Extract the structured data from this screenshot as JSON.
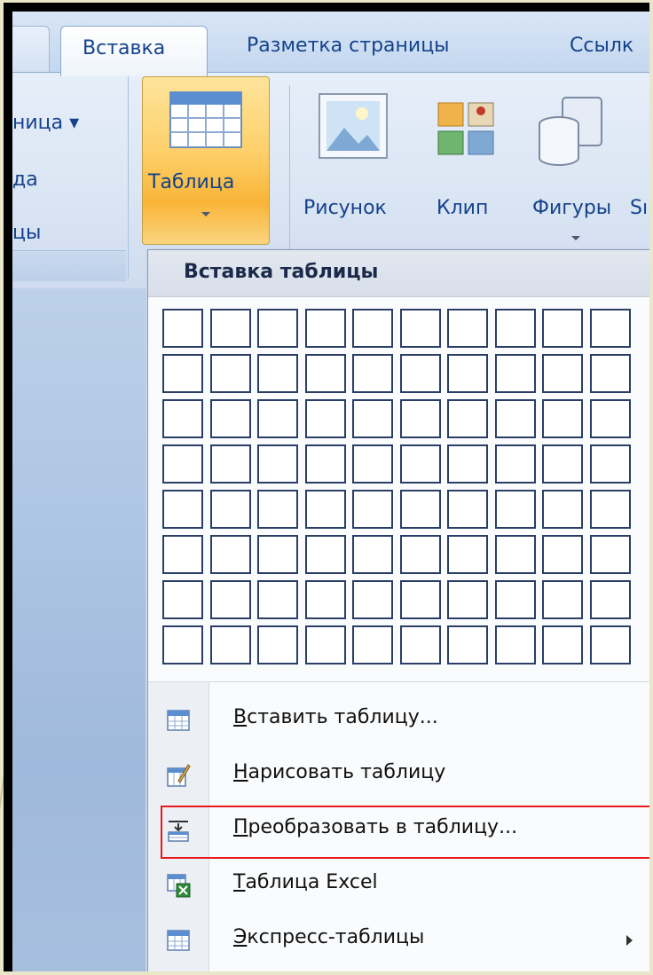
{
  "ribbon": {
    "tabs": [
      {
        "label": "Вставка",
        "active": true
      },
      {
        "label": "Разметка страницы",
        "active": false
      },
      {
        "label": "Ссылк",
        "active": false
      }
    ],
    "left_group_items": [
      "ница ▾",
      "да",
      "цы"
    ],
    "buttons": {
      "table": "Таблица",
      "picture": "Рисунок",
      "clip": "Клип",
      "shapes": "Фигуры",
      "smartart": "Sı"
    }
  },
  "menu": {
    "header": "Вставка таблицы",
    "grid": {
      "columns": 10,
      "rows": 8
    },
    "items": [
      {
        "access_key": "В",
        "rest": "ставить таблицу...",
        "icon": "insert-table-icon",
        "submenu": false,
        "highlighted": false
      },
      {
        "access_key": "Н",
        "rest": "арисовать таблицу",
        "icon": "draw-table-icon",
        "submenu": false,
        "highlighted": false
      },
      {
        "access_key": "П",
        "rest": "реобразовать в таблицу...",
        "icon": "convert-to-table-icon",
        "submenu": false,
        "highlighted": true
      },
      {
        "access_key": "Т",
        "rest": "аблица Excel",
        "icon": "excel-table-icon",
        "submenu": false,
        "highlighted": false
      },
      {
        "access_key": "Э",
        "rest": "кспресс-таблицы",
        "icon": "quick-tables-icon",
        "submenu": true,
        "highlighted": false
      }
    ]
  },
  "colors": {
    "highlight_border": "#e8191b",
    "active_button": "#fdd06a",
    "ribbon_text": "#15428b"
  }
}
